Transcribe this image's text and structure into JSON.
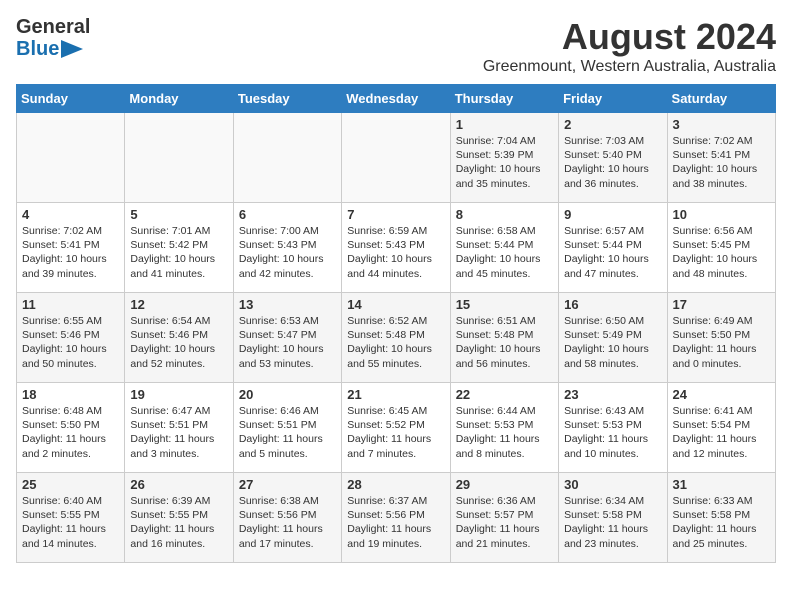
{
  "header": {
    "logo_line1": "General",
    "logo_line2": "Blue",
    "title": "August 2024",
    "subtitle": "Greenmount, Western Australia, Australia"
  },
  "calendar": {
    "days_of_week": [
      "Sunday",
      "Monday",
      "Tuesday",
      "Wednesday",
      "Thursday",
      "Friday",
      "Saturday"
    ],
    "weeks": [
      [
        {
          "day": "",
          "info": ""
        },
        {
          "day": "",
          "info": ""
        },
        {
          "day": "",
          "info": ""
        },
        {
          "day": "",
          "info": ""
        },
        {
          "day": "1",
          "info": "Sunrise: 7:04 AM\nSunset: 5:39 PM\nDaylight: 10 hours\nand 35 minutes."
        },
        {
          "day": "2",
          "info": "Sunrise: 7:03 AM\nSunset: 5:40 PM\nDaylight: 10 hours\nand 36 minutes."
        },
        {
          "day": "3",
          "info": "Sunrise: 7:02 AM\nSunset: 5:41 PM\nDaylight: 10 hours\nand 38 minutes."
        }
      ],
      [
        {
          "day": "4",
          "info": "Sunrise: 7:02 AM\nSunset: 5:41 PM\nDaylight: 10 hours\nand 39 minutes."
        },
        {
          "day": "5",
          "info": "Sunrise: 7:01 AM\nSunset: 5:42 PM\nDaylight: 10 hours\nand 41 minutes."
        },
        {
          "day": "6",
          "info": "Sunrise: 7:00 AM\nSunset: 5:43 PM\nDaylight: 10 hours\nand 42 minutes."
        },
        {
          "day": "7",
          "info": "Sunrise: 6:59 AM\nSunset: 5:43 PM\nDaylight: 10 hours\nand 44 minutes."
        },
        {
          "day": "8",
          "info": "Sunrise: 6:58 AM\nSunset: 5:44 PM\nDaylight: 10 hours\nand 45 minutes."
        },
        {
          "day": "9",
          "info": "Sunrise: 6:57 AM\nSunset: 5:44 PM\nDaylight: 10 hours\nand 47 minutes."
        },
        {
          "day": "10",
          "info": "Sunrise: 6:56 AM\nSunset: 5:45 PM\nDaylight: 10 hours\nand 48 minutes."
        }
      ],
      [
        {
          "day": "11",
          "info": "Sunrise: 6:55 AM\nSunset: 5:46 PM\nDaylight: 10 hours\nand 50 minutes."
        },
        {
          "day": "12",
          "info": "Sunrise: 6:54 AM\nSunset: 5:46 PM\nDaylight: 10 hours\nand 52 minutes."
        },
        {
          "day": "13",
          "info": "Sunrise: 6:53 AM\nSunset: 5:47 PM\nDaylight: 10 hours\nand 53 minutes."
        },
        {
          "day": "14",
          "info": "Sunrise: 6:52 AM\nSunset: 5:48 PM\nDaylight: 10 hours\nand 55 minutes."
        },
        {
          "day": "15",
          "info": "Sunrise: 6:51 AM\nSunset: 5:48 PM\nDaylight: 10 hours\nand 56 minutes."
        },
        {
          "day": "16",
          "info": "Sunrise: 6:50 AM\nSunset: 5:49 PM\nDaylight: 10 hours\nand 58 minutes."
        },
        {
          "day": "17",
          "info": "Sunrise: 6:49 AM\nSunset: 5:50 PM\nDaylight: 11 hours\nand 0 minutes."
        }
      ],
      [
        {
          "day": "18",
          "info": "Sunrise: 6:48 AM\nSunset: 5:50 PM\nDaylight: 11 hours\nand 2 minutes."
        },
        {
          "day": "19",
          "info": "Sunrise: 6:47 AM\nSunset: 5:51 PM\nDaylight: 11 hours\nand 3 minutes."
        },
        {
          "day": "20",
          "info": "Sunrise: 6:46 AM\nSunset: 5:51 PM\nDaylight: 11 hours\nand 5 minutes."
        },
        {
          "day": "21",
          "info": "Sunrise: 6:45 AM\nSunset: 5:52 PM\nDaylight: 11 hours\nand 7 minutes."
        },
        {
          "day": "22",
          "info": "Sunrise: 6:44 AM\nSunset: 5:53 PM\nDaylight: 11 hours\nand 8 minutes."
        },
        {
          "day": "23",
          "info": "Sunrise: 6:43 AM\nSunset: 5:53 PM\nDaylight: 11 hours\nand 10 minutes."
        },
        {
          "day": "24",
          "info": "Sunrise: 6:41 AM\nSunset: 5:54 PM\nDaylight: 11 hours\nand 12 minutes."
        }
      ],
      [
        {
          "day": "25",
          "info": "Sunrise: 6:40 AM\nSunset: 5:55 PM\nDaylight: 11 hours\nand 14 minutes."
        },
        {
          "day": "26",
          "info": "Sunrise: 6:39 AM\nSunset: 5:55 PM\nDaylight: 11 hours\nand 16 minutes."
        },
        {
          "day": "27",
          "info": "Sunrise: 6:38 AM\nSunset: 5:56 PM\nDaylight: 11 hours\nand 17 minutes."
        },
        {
          "day": "28",
          "info": "Sunrise: 6:37 AM\nSunset: 5:56 PM\nDaylight: 11 hours\nand 19 minutes."
        },
        {
          "day": "29",
          "info": "Sunrise: 6:36 AM\nSunset: 5:57 PM\nDaylight: 11 hours\nand 21 minutes."
        },
        {
          "day": "30",
          "info": "Sunrise: 6:34 AM\nSunset: 5:58 PM\nDaylight: 11 hours\nand 23 minutes."
        },
        {
          "day": "31",
          "info": "Sunrise: 6:33 AM\nSunset: 5:58 PM\nDaylight: 11 hours\nand 25 minutes."
        }
      ]
    ]
  }
}
